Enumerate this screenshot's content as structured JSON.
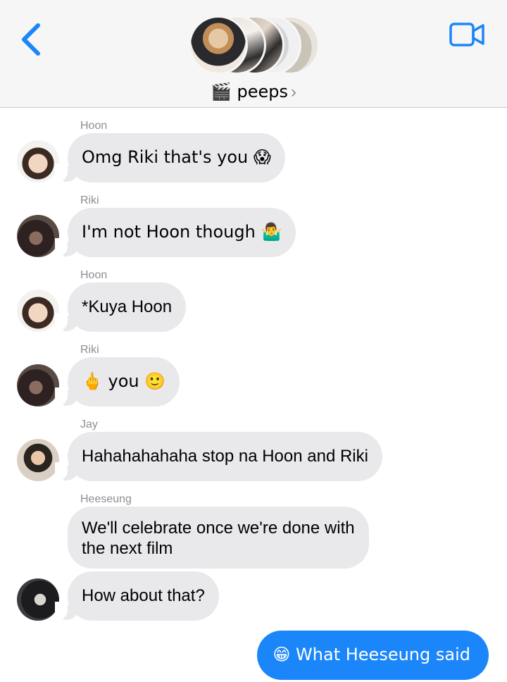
{
  "header": {
    "group_name": "🎬 peeps",
    "chevron": "›",
    "icons": {
      "back": "chevron-left-icon",
      "video": "video-camera-icon"
    },
    "accent_color": "#1b86f9"
  },
  "messages": [
    {
      "sender": "Hoon",
      "text": "Omg Riki that's you 😱",
      "direction": "incoming"
    },
    {
      "sender": "Riki",
      "text": "I'm not Hoon though 🤷‍♂️",
      "direction": "incoming"
    },
    {
      "sender": "Hoon",
      "text": "*Kuya Hoon",
      "direction": "incoming"
    },
    {
      "sender": "Riki",
      "text": "🖕 you 🙂",
      "direction": "incoming"
    },
    {
      "sender": "Jay",
      "text": "Hahahahahaha stop na Hoon and Riki",
      "direction": "incoming"
    },
    {
      "sender": "Heeseung",
      "text_line1": "We'll celebrate once we're done with",
      "text_line2": "the next film",
      "direction": "incoming"
    },
    {
      "sender": "",
      "text": "How about that?",
      "direction": "incoming"
    },
    {
      "sender": "",
      "text": "😁 What Heeseung said",
      "direction": "outgoing"
    }
  ]
}
